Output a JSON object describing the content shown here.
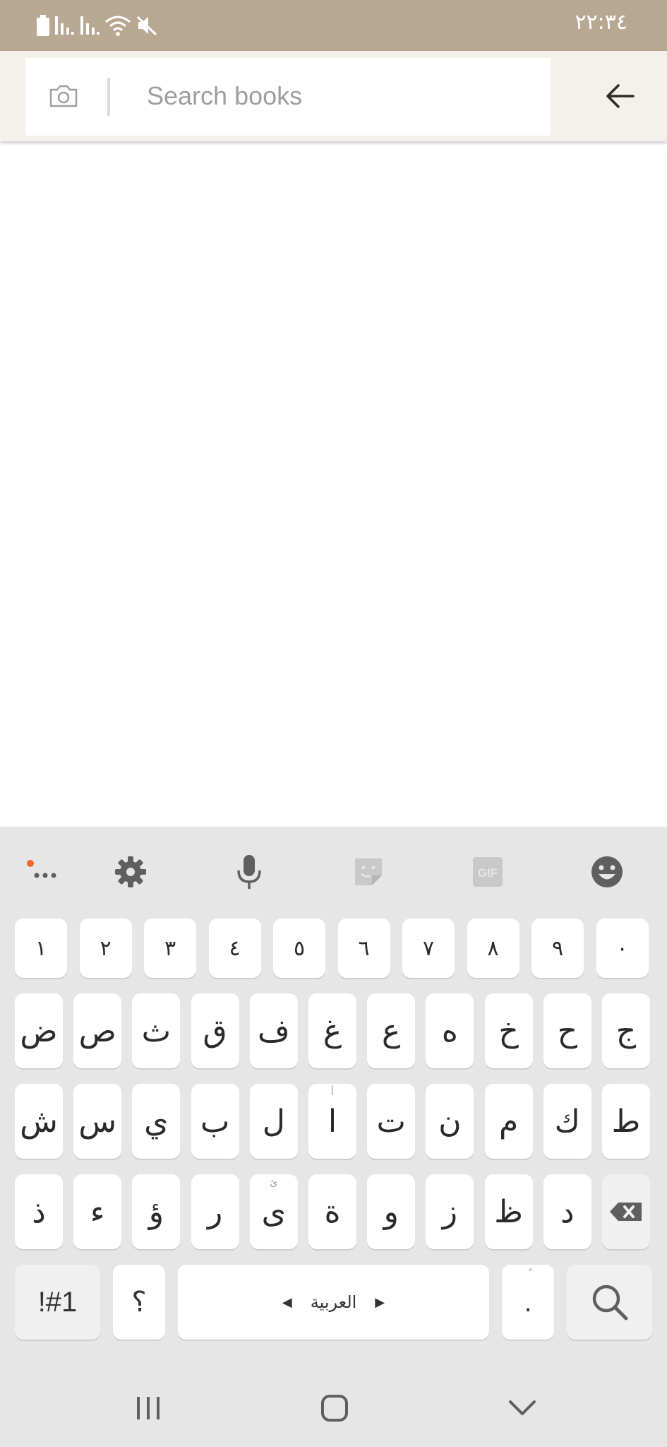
{
  "status_bar": {
    "time": "٢٢:٣٤",
    "icons": [
      "battery-icon",
      "signal-icon",
      "signal-icon",
      "wifi-icon",
      "mute-icon"
    ]
  },
  "search": {
    "placeholder": "Search books",
    "value": "",
    "camera_icon": "camera-icon",
    "back_icon": "arrow-left-icon"
  },
  "keyboard": {
    "toolbar": [
      "more-icon",
      "gear-icon",
      "microphone-icon",
      "sticker-icon",
      "gif-icon",
      "emoji-icon"
    ],
    "gif_label": "GIF",
    "number_row": [
      "١",
      "٢",
      "٣",
      "٤",
      "٥",
      "٦",
      "٧",
      "٨",
      "٩",
      "٠"
    ],
    "row1": [
      "ض",
      "ص",
      "ث",
      "ق",
      "ف",
      "غ",
      "ع",
      "ه",
      "خ",
      "ح",
      "ج"
    ],
    "row2": [
      "ش",
      "س",
      "ي",
      "ب",
      "ل",
      "ا",
      "ت",
      "ن",
      "م",
      "ك",
      "ط"
    ],
    "row2_hints": [
      "",
      "",
      "",
      "",
      "",
      "أ",
      "",
      "",
      "",
      "",
      ""
    ],
    "row3": [
      "ذ",
      "ء",
      "ؤ",
      "ر",
      "ى",
      "ة",
      "و",
      "ز",
      "ظ",
      "د"
    ],
    "row3_hints": [
      "",
      "",
      "",
      "",
      "ئ",
      "",
      "",
      "",
      "",
      ""
    ],
    "symbols_key": "!#1",
    "question_key": "؟",
    "space_label": "العربية",
    "period_key": ".",
    "period_hint": "ّ"
  },
  "colors": {
    "status_bar": "#b8a791",
    "header": "#f4f1eb",
    "keyboard": "#e6e6e6",
    "accent_dot": "#f2662a"
  }
}
